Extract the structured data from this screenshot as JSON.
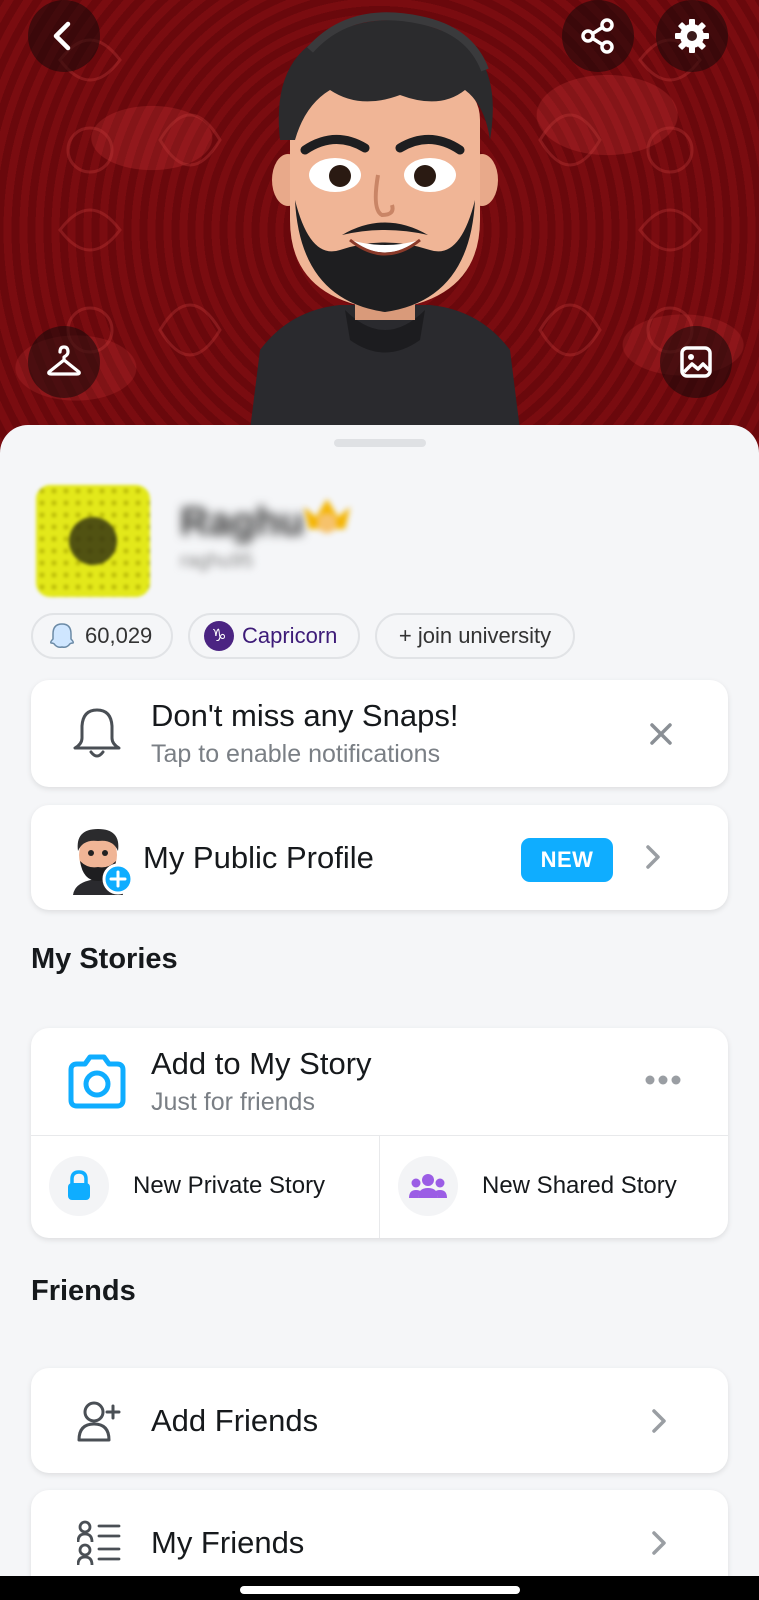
{
  "header": {
    "back_icon": "chevron-left-icon",
    "share_icon": "share-icon",
    "settings_icon": "gear-icon",
    "wardrobe_icon": "hanger-icon",
    "background_icon": "image-icon"
  },
  "profile": {
    "display_name": "Raghu",
    "username": "raghu95",
    "snap_score": "60,029",
    "zodiac_label": "Capricorn",
    "zodiac_symbol": "♑",
    "university_label": "+ join university"
  },
  "notification_card": {
    "title": "Don't miss any Snaps!",
    "subtitle": "Tap to enable notifications"
  },
  "public_profile": {
    "label": "My Public Profile",
    "badge": "NEW"
  },
  "my_stories": {
    "section_title": "My Stories",
    "add_story_title": "Add to My Story",
    "add_story_subtitle": "Just for friends",
    "private_story_label": "New Private Story",
    "shared_story_label": "New Shared Story"
  },
  "friends": {
    "section_title": "Friends",
    "add_friends_label": "Add Friends",
    "my_friends_label": "My Friends"
  },
  "colors": {
    "accent_blue": "#0fadff",
    "capricorn_purple": "#4b2482",
    "shared_story_purple": "#9b5de5",
    "header_red": "#7a0c10"
  }
}
